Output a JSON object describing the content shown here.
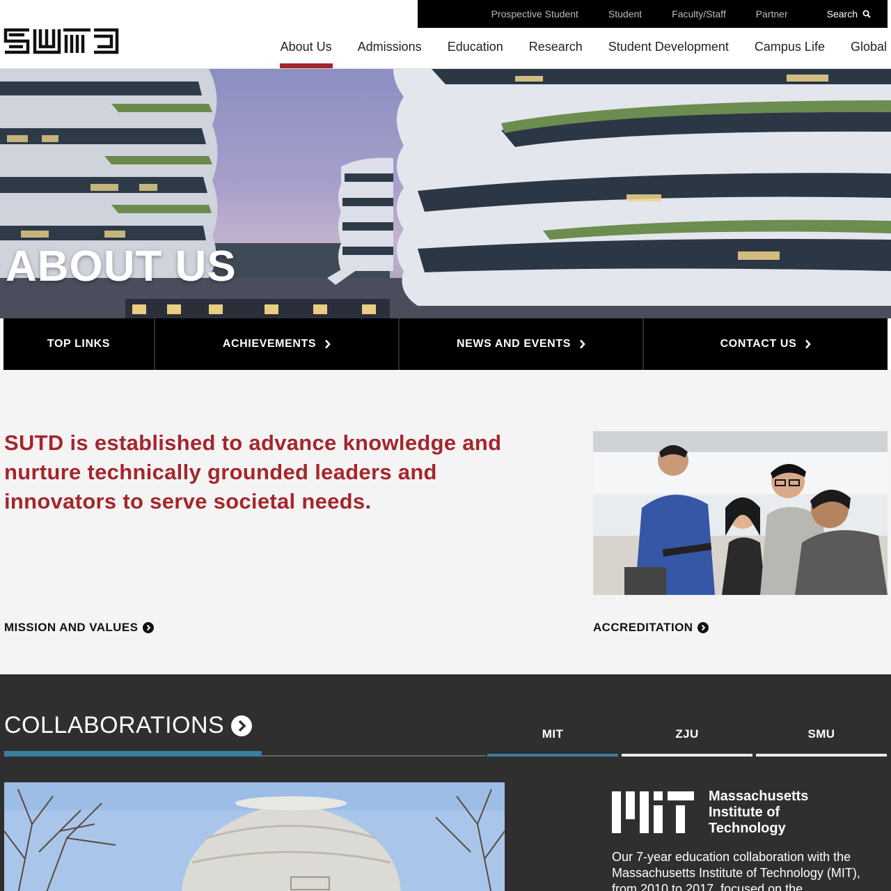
{
  "utility_nav": {
    "items": [
      "Prospective Student",
      "Student",
      "Faculty/Staff",
      "Partner"
    ],
    "search_label": "Search"
  },
  "logo_text": "SUTD",
  "main_nav": {
    "items": [
      "About Us",
      "Admissions",
      "Education",
      "Research",
      "Student Development",
      "Campus Life",
      "Global"
    ],
    "active": "About Us"
  },
  "hero": {
    "title": "ABOUT US"
  },
  "subtabs": [
    {
      "label": "TOP LINKS",
      "has_chevron": false
    },
    {
      "label": "ACHIEVEMENTS",
      "has_chevron": true
    },
    {
      "label": "NEWS AND EVENTS",
      "has_chevron": true
    },
    {
      "label": "CONTACT US",
      "has_chevron": true
    }
  ],
  "intro": {
    "mission_statement": "SUTD is established to advance knowledge and nurture technically grounded leaders and innovators to serve societal needs.",
    "mission_link": "MISSION AND VALUES",
    "accreditation_link": "ACCREDITATION"
  },
  "collaborations": {
    "title": "COLLABORATIONS",
    "tabs": [
      "MIT",
      "ZJU",
      "SMU"
    ],
    "active_tab": "MIT",
    "mit": {
      "name_line1": "Massachusetts",
      "name_line2": "Institute of",
      "name_line3": "Technology",
      "description": "Our 7-year education collaboration with the Massachusetts Institute of Technology (MIT), from 2010 to 2017, focused on the"
    }
  },
  "colors": {
    "brand_red": "#a4262c",
    "accent_blue": "#3a7ea0",
    "dark_bg": "#2f2f2f",
    "light_bg": "#f4f4f4"
  }
}
